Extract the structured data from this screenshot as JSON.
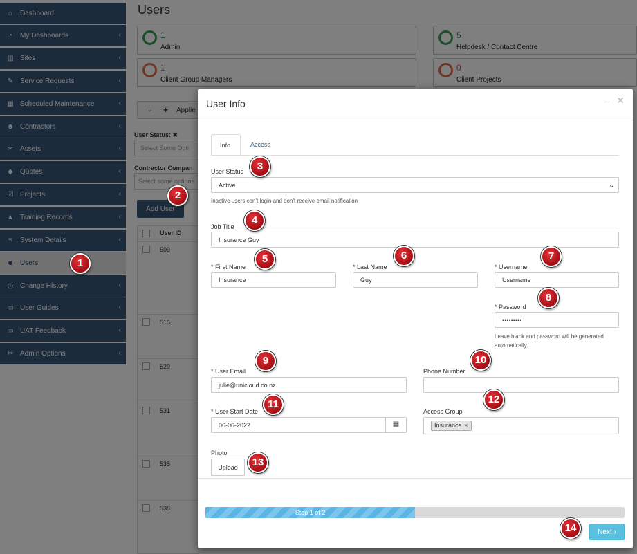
{
  "sidebar": {
    "items": [
      {
        "label": "Dashboard",
        "icon": "home-icon",
        "chevron": false
      },
      {
        "label": "My Dashboards",
        "icon": "dashboard-icon",
        "chevron": true
      },
      {
        "label": "Sites",
        "icon": "building-icon",
        "chevron": true
      },
      {
        "label": "Service Requests",
        "icon": "wrench-icon",
        "chevron": true
      },
      {
        "label": "Scheduled Maintenance",
        "icon": "calendar-icon",
        "chevron": true
      },
      {
        "label": "Contractors",
        "icon": "users-icon",
        "chevron": true
      },
      {
        "label": "Assets",
        "icon": "tools-icon",
        "chevron": true
      },
      {
        "label": "Quotes",
        "icon": "tag-icon",
        "chevron": true
      },
      {
        "label": "Projects",
        "icon": "checkbox-icon",
        "chevron": true
      },
      {
        "label": "Training Records",
        "icon": "graduation-cap-icon",
        "chevron": true
      },
      {
        "label": "System Details",
        "icon": "list-icon",
        "chevron": true
      },
      {
        "label": "Users",
        "icon": "users-icon",
        "chevron": false,
        "active": true
      },
      {
        "label": "Change History",
        "icon": "clock-icon",
        "chevron": true
      },
      {
        "label": "User Guides",
        "icon": "folder-icon",
        "chevron": true
      },
      {
        "label": "UAT Feedback",
        "icon": "folder-icon",
        "chevron": true
      },
      {
        "label": "Admin Options",
        "icon": "tools-icon",
        "chevron": true
      }
    ]
  },
  "background": {
    "title": "Users",
    "cards": [
      {
        "count": "1",
        "label": "Admin",
        "status": "green"
      },
      {
        "count": "5",
        "label": "Helpdesk / Contact Centre",
        "status": "green"
      },
      {
        "count": "1",
        "label": "Client Group Managers",
        "status": "red"
      },
      {
        "count": "0",
        "label": "Client Projects",
        "status": "red"
      }
    ],
    "applied_filters_label": "Applie",
    "user_status_label": "User Status:",
    "user_status_placeholder": "Select Some Opti",
    "contractor_label": "Contractor Compan",
    "contractor_placeholder": "Select some options",
    "add_user_label": "Add User",
    "user_id_header": "User ID",
    "rows": [
      "509",
      "515",
      "529",
      "531",
      "535",
      "538"
    ]
  },
  "modal": {
    "title": "User Info",
    "tabs": [
      "Info",
      "Access"
    ],
    "user_status": {
      "label": "User Status",
      "value": "Active",
      "help": "Inactive users can't login and don't receive email notification"
    },
    "job_title": {
      "label": "Job Title",
      "value": "Insurance Guy"
    },
    "first_name": {
      "label": "* First Name",
      "value": "Insurance"
    },
    "last_name": {
      "label": "* Last Name",
      "value": "Guy"
    },
    "username": {
      "label": "* Username",
      "value": "Username"
    },
    "password": {
      "label": "* Password",
      "value": "•••••••••",
      "help": "Leave blank and password will be generated automatically."
    },
    "user_email": {
      "label": "* User Email",
      "value": "julie@unicloud.co.nz"
    },
    "phone": {
      "label": "Phone Number",
      "value": ""
    },
    "start_date": {
      "label": "* User Start Date",
      "value": "06-06-2022"
    },
    "access_group": {
      "label": "Access Group",
      "tag": "Insurance",
      "tag_remove": "×"
    },
    "photo": {
      "label": "Photo",
      "upload_label": "Upload"
    },
    "progress": {
      "label": "Step 1 of 2",
      "fraction": 0.5
    },
    "next_label": "Next ›"
  },
  "markers": [
    "1",
    "2",
    "3",
    "4",
    "5",
    "6",
    "7",
    "8",
    "9",
    "10",
    "11",
    "12",
    "13",
    "14"
  ],
  "colors": {
    "sidebar": "#385778",
    "marker": "#c41a20",
    "progress": "#5bb4e4",
    "next": "#5bc0de"
  }
}
